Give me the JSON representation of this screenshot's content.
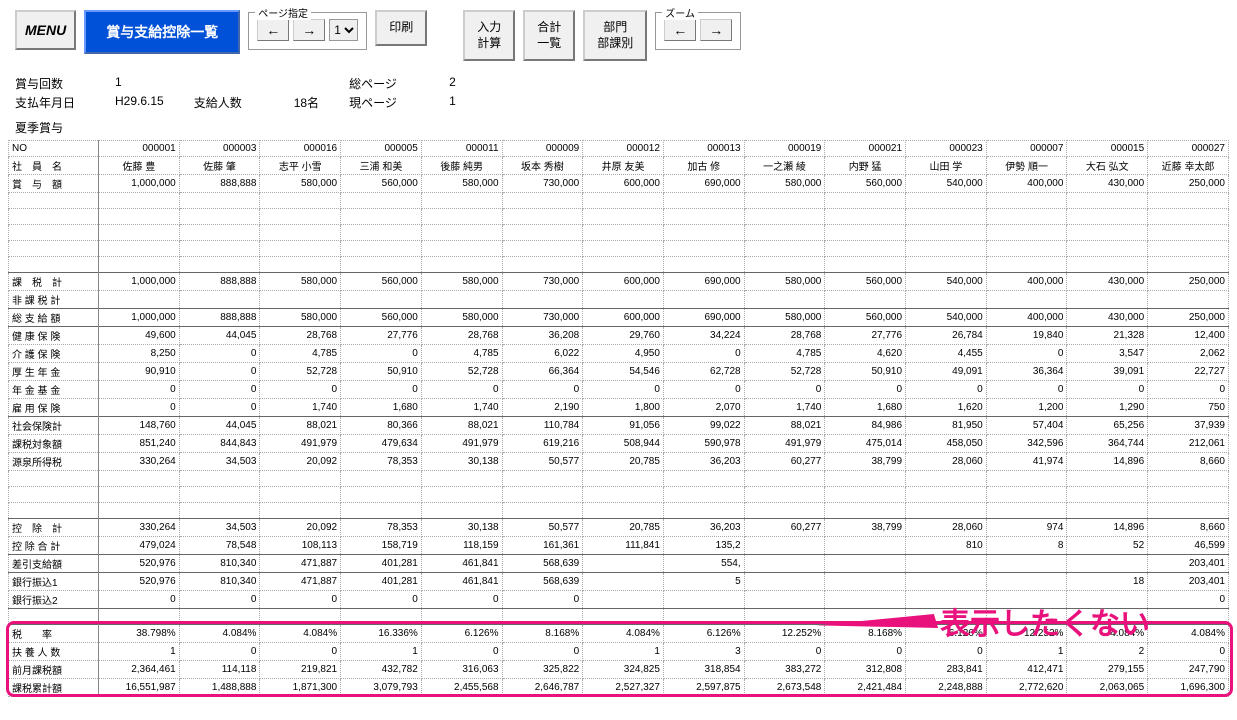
{
  "toolbar": {
    "menu_label": "MENU",
    "title_label": "賞与支給控除一覧",
    "page_group_label": "ページ指定",
    "prev_label": "←",
    "next_label": "→",
    "page_value": "1",
    "print_label": "印刷",
    "calc_label": "入力\n計算",
    "total_label": "合計\n一覧",
    "dept_label": "部門\n部課別",
    "zoom_group_label": "ズーム",
    "zoom_prev": "←",
    "zoom_next": "→"
  },
  "info": {
    "bonus_count_label": "賞与回数",
    "bonus_count_value": "1",
    "pay_date_label": "支払年月日",
    "pay_date_value": "H29.6.15",
    "pay_people_label": "支給人数",
    "pay_people_value": "18名",
    "total_page_label": "総ページ",
    "total_page_value": "2",
    "cur_page_label": "現ページ",
    "cur_page_value": "1",
    "subtitle": "夏季賞与"
  },
  "columns": [
    "000001",
    "000003",
    "000016",
    "000005",
    "000011",
    "000009",
    "000012",
    "000013",
    "000019",
    "000021",
    "000023",
    "000007",
    "000015",
    "000027"
  ],
  "names": [
    "佐藤 豊",
    "佐藤 肇",
    "志平 小雪",
    "三浦 和美",
    "後藤 純男",
    "坂本 秀樹",
    "井原 友美",
    "加古 修",
    "一之瀬 綾",
    "内野 猛",
    "山田 学",
    "伊勢 順一",
    "大石 弘文",
    "近藤 幸太郎"
  ],
  "rows": [
    {
      "label": "NO",
      "vals": [
        "000001",
        "000003",
        "000016",
        "000005",
        "000011",
        "000009",
        "000012",
        "000013",
        "000019",
        "000021",
        "000023",
        "000007",
        "000015",
        "000027"
      ]
    },
    {
      "label": "社　員　名",
      "vals": [
        "佐藤 豊",
        "佐藤 肇",
        "志平 小雪",
        "三浦 和美",
        "後藤 純男",
        "坂本 秀樹",
        "井原 友美",
        "加古 修",
        "一之瀬 綾",
        "内野 猛",
        "山田 学",
        "伊勢 順一",
        "大石 弘文",
        "近藤 幸太郎"
      ],
      "align": "center"
    },
    {
      "label": "賞　与　額",
      "vals": [
        "1,000,000",
        "888,888",
        "580,000",
        "560,000",
        "580,000",
        "730,000",
        "600,000",
        "690,000",
        "580,000",
        "560,000",
        "540,000",
        "400,000",
        "430,000",
        "250,000"
      ]
    },
    {
      "label": "",
      "vals": [
        "",
        "",
        "",
        "",
        "",
        "",
        "",
        "",
        "",
        "",
        "",
        "",
        "",
        ""
      ]
    },
    {
      "label": "",
      "vals": [
        "",
        "",
        "",
        "",
        "",
        "",
        "",
        "",
        "",
        "",
        "",
        "",
        "",
        ""
      ]
    },
    {
      "label": "",
      "vals": [
        "",
        "",
        "",
        "",
        "",
        "",
        "",
        "",
        "",
        "",
        "",
        "",
        "",
        ""
      ]
    },
    {
      "label": "",
      "vals": [
        "",
        "",
        "",
        "",
        "",
        "",
        "",
        "",
        "",
        "",
        "",
        "",
        "",
        ""
      ]
    },
    {
      "label": "",
      "vals": [
        "",
        "",
        "",
        "",
        "",
        "",
        "",
        "",
        "",
        "",
        "",
        "",
        "",
        ""
      ]
    },
    {
      "label": "課　税　計",
      "vals": [
        "1,000,000",
        "888,888",
        "580,000",
        "560,000",
        "580,000",
        "730,000",
        "600,000",
        "690,000",
        "580,000",
        "560,000",
        "540,000",
        "400,000",
        "430,000",
        "250,000"
      ],
      "solid": true
    },
    {
      "label": "非 課 税 計",
      "vals": [
        "",
        "",
        "",
        "",
        "",
        "",
        "",
        "",
        "",
        "",
        "",
        "",
        "",
        ""
      ]
    },
    {
      "label": "総 支 給 額",
      "vals": [
        "1,000,000",
        "888,888",
        "580,000",
        "560,000",
        "580,000",
        "730,000",
        "600,000",
        "690,000",
        "580,000",
        "560,000",
        "540,000",
        "400,000",
        "430,000",
        "250,000"
      ],
      "solid": true
    },
    {
      "label": "健 康 保 険",
      "vals": [
        "49,600",
        "44,045",
        "28,768",
        "27,776",
        "28,768",
        "36,208",
        "29,760",
        "34,224",
        "28,768",
        "27,776",
        "26,784",
        "19,840",
        "21,328",
        "12,400"
      ],
      "solid": true
    },
    {
      "label": "介 護 保 険",
      "vals": [
        "8,250",
        "0",
        "4,785",
        "0",
        "4,785",
        "6,022",
        "4,950",
        "0",
        "4,785",
        "4,620",
        "4,455",
        "0",
        "3,547",
        "2,062"
      ]
    },
    {
      "label": "厚 生 年 金",
      "vals": [
        "90,910",
        "0",
        "52,728",
        "50,910",
        "52,728",
        "66,364",
        "54,546",
        "62,728",
        "52,728",
        "50,910",
        "49,091",
        "36,364",
        "39,091",
        "22,727"
      ]
    },
    {
      "label": "年 金 基 金",
      "vals": [
        "0",
        "0",
        "0",
        "0",
        "0",
        "0",
        "0",
        "0",
        "0",
        "0",
        "0",
        "0",
        "0",
        "0"
      ]
    },
    {
      "label": "雇 用 保 険",
      "vals": [
        "0",
        "0",
        "1,740",
        "1,680",
        "1,740",
        "2,190",
        "1,800",
        "2,070",
        "1,740",
        "1,680",
        "1,620",
        "1,200",
        "1,290",
        "750"
      ]
    },
    {
      "label": "社会保険計",
      "vals": [
        "148,760",
        "44,045",
        "88,021",
        "80,366",
        "88,021",
        "110,784",
        "91,056",
        "99,022",
        "88,021",
        "84,986",
        "81,950",
        "57,404",
        "65,256",
        "37,939"
      ],
      "solid": true
    },
    {
      "label": "課税対象額",
      "vals": [
        "851,240",
        "844,843",
        "491,979",
        "479,634",
        "491,979",
        "619,216",
        "508,944",
        "590,978",
        "491,979",
        "475,014",
        "458,050",
        "342,596",
        "364,744",
        "212,061"
      ]
    },
    {
      "label": "源泉所得税",
      "vals": [
        "330,264",
        "34,503",
        "20,092",
        "78,353",
        "30,138",
        "50,577",
        "20,785",
        "36,203",
        "60,277",
        "38,799",
        "28,060",
        "41,974",
        "14,896",
        "8,660"
      ]
    },
    {
      "label": "",
      "vals": [
        "",
        "",
        "",
        "",
        "",
        "",
        "",
        "",
        "",
        "",
        "",
        "",
        "",
        ""
      ]
    },
    {
      "label": "",
      "vals": [
        "",
        "",
        "",
        "",
        "",
        "",
        "",
        "",
        "",
        "",
        "",
        "",
        "",
        ""
      ]
    },
    {
      "label": "",
      "vals": [
        "",
        "",
        "",
        "",
        "",
        "",
        "",
        "",
        "",
        "",
        "",
        "",
        "",
        ""
      ]
    },
    {
      "label": "控　除　計",
      "vals": [
        "330,264",
        "34,503",
        "20,092",
        "78,353",
        "30,138",
        "50,577",
        "20,785",
        "36,203",
        "60,277",
        "38,799",
        "28,060",
        "974",
        "14,896",
        "8,660"
      ],
      "solid": true
    },
    {
      "label": "控 除 合 計",
      "vals": [
        "479,024",
        "78,548",
        "108,113",
        "158,719",
        "118,159",
        "161,361",
        "111,841",
        "135,2",
        "",
        "",
        "810",
        "8",
        "52",
        "46,599"
      ]
    },
    {
      "label": "差引支給額",
      "vals": [
        "520,976",
        "810,340",
        "471,887",
        "401,281",
        "461,841",
        "568,639",
        "",
        "554,",
        "",
        "",
        "",
        "",
        "",
        "203,401"
      ],
      "solid": true
    },
    {
      "label": "銀行振込1",
      "vals": [
        "520,976",
        "810,340",
        "471,887",
        "401,281",
        "461,841",
        "568,639",
        "",
        "5",
        "",
        "",
        "",
        "",
        "18",
        "203,401"
      ],
      "solid": true
    },
    {
      "label": "銀行振込2",
      "vals": [
        "0",
        "0",
        "0",
        "0",
        "0",
        "0",
        "",
        "",
        "",
        "",
        "",
        "",
        "",
        "0"
      ]
    },
    {
      "label": "",
      "vals": [
        "",
        "",
        "",
        "",
        "",
        "",
        "",
        "",
        "",
        "",
        "",
        "",
        "",
        ""
      ],
      "solid": true
    },
    {
      "label": "税　　率",
      "vals": [
        "38.798%",
        "4.084%",
        "4.084%",
        "16.336%",
        "6.126%",
        "8.168%",
        "4.084%",
        "6.126%",
        "12.252%",
        "8.168%",
        "6.126%",
        "12.252%",
        "4.084%",
        "4.084%"
      ],
      "solid": true
    },
    {
      "label": "扶 養 人 数",
      "vals": [
        "1",
        "0",
        "0",
        "1",
        "0",
        "0",
        "1",
        "3",
        "0",
        "0",
        "0",
        "1",
        "2",
        "0"
      ]
    },
    {
      "label": "前月課税額",
      "vals": [
        "2,364,461",
        "114,118",
        "219,821",
        "432,782",
        "316,063",
        "325,822",
        "324,825",
        "318,854",
        "383,272",
        "312,808",
        "283,841",
        "412,471",
        "279,155",
        "247,790"
      ]
    },
    {
      "label": "課税累計額",
      "vals": [
        "16,551,987",
        "1,488,888",
        "1,871,300",
        "3,079,793",
        "2,455,568",
        "2,646,787",
        "2,527,327",
        "2,597,875",
        "2,673,548",
        "2,421,484",
        "2,248,888",
        "2,772,620",
        "2,063,065",
        "1,696,300"
      ]
    }
  ],
  "annotation_text": "表示したくない"
}
